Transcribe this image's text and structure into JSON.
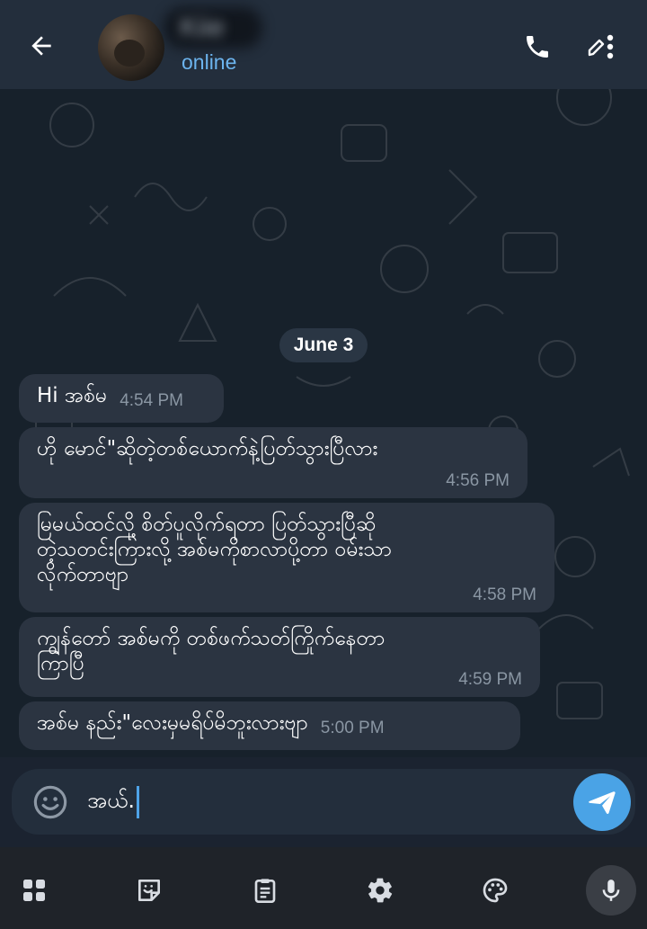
{
  "header": {
    "contact_name": "Kiie",
    "status": "online",
    "icons": [
      "arrow-left-icon",
      "phone-icon",
      "pencil-icon",
      "kebab-menu-icon"
    ]
  },
  "chat": {
    "date_separator": "June 3",
    "messages": [
      {
        "text": "Hi အစ်မ",
        "time": "4:54 PM"
      },
      {
        "text": "ဟို မောင်\"ဆိုတဲ့တစ်ယောက်နဲ့ပြတ်သွားပြီလား",
        "time": "4:56 PM"
      },
      {
        "text": "မြမယ်ထင်လို့ စိတ်ပူလိုက်ရတာ ပြတ်သွားပြီဆို\nတဲ့သတင်းကြားလို့ အစ်မကိုစာလာပို့တာ ဝမ်းသာ\nလိုက်တာဗျာ",
        "time": "4:58 PM"
      },
      {
        "text": "ကျွန်တော် အစ်မကို တစ်ဖက်သတ်ကြိုက်နေတာ\nကြာပြီ",
        "time": "4:59 PM"
      },
      {
        "text": "အစ်မ နည်း\"လေးမှမရိပ်မိဘူးလားဗျာ",
        "time": "5:00 PM"
      }
    ]
  },
  "composer": {
    "value": "အယ်.",
    "icons": [
      "emoji-icon",
      "send-icon"
    ]
  },
  "keyboard_toolbar": {
    "icons": [
      "apps-grid-icon",
      "sticker-icon",
      "clipboard-icon",
      "settings-icon",
      "palette-icon",
      "microphone-icon"
    ]
  },
  "colors": {
    "header_bg": "#232e3c",
    "chat_bg": "#17212b",
    "bubble_bg": "#2b3441",
    "status": "#6cb4ee",
    "send_button": "#4aa3e6"
  }
}
